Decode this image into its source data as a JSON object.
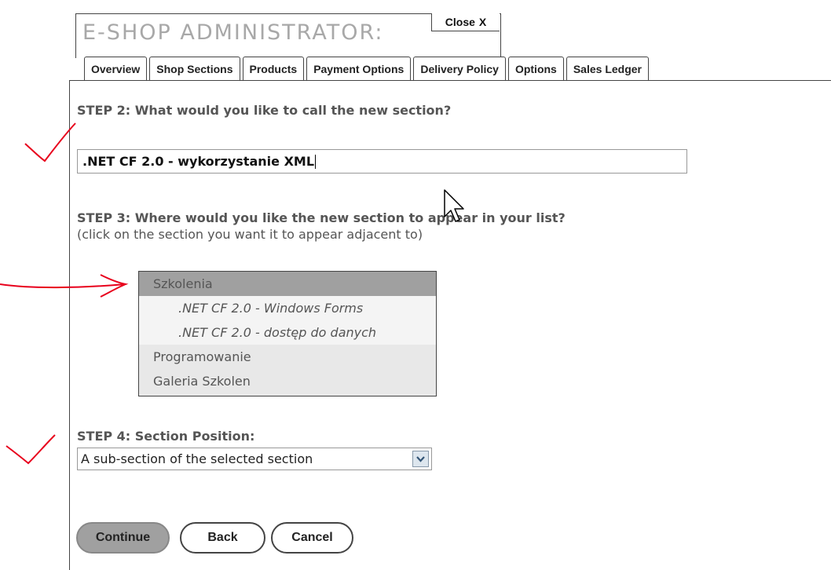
{
  "header": {
    "title": "E-SHOP ADMINISTRATOR:",
    "close_label": "Close",
    "close_glyph": "X"
  },
  "tabs": [
    {
      "label": "Overview",
      "active": false
    },
    {
      "label": "Shop Sections",
      "active": true
    },
    {
      "label": "Products",
      "active": false
    },
    {
      "label": "Payment Options",
      "active": false
    },
    {
      "label": "Delivery Policy",
      "active": false
    },
    {
      "label": "Options",
      "active": false
    },
    {
      "label": "Sales Ledger",
      "active": false
    }
  ],
  "step2": {
    "label": "STEP 2: What would you like to call the new section?",
    "value": ".NET CF 2.0 - wykorzystanie XML"
  },
  "step3": {
    "label": "STEP 3: Where would you like the new section to appear in your list?",
    "hint": "(click on the section you want it to appear adjacent to)",
    "sections": [
      {
        "label": "Szkolenia",
        "selected": true,
        "child": false
      },
      {
        "label": ".NET CF 2.0 - Windows Forms",
        "selected": false,
        "child": true
      },
      {
        "label": ".NET CF 2.0 - dostęp do danych",
        "selected": false,
        "child": true
      },
      {
        "label": "Programowanie",
        "selected": false,
        "child": false
      },
      {
        "label": "Galeria Szkolen",
        "selected": false,
        "child": false
      }
    ]
  },
  "step4": {
    "label": "STEP 4: Section Position:",
    "selected": "A sub-section of the selected section"
  },
  "buttons": {
    "continue": "Continue",
    "back": "Back",
    "cancel": "Cancel"
  },
  "colors": {
    "annotation": "#e8001c",
    "selected_row": "#a0a0a0",
    "list_bg": "#e8e8e8"
  },
  "icons": {
    "select_arrow": "chevron-down-icon",
    "cursor": "mouse-pointer-icon"
  }
}
